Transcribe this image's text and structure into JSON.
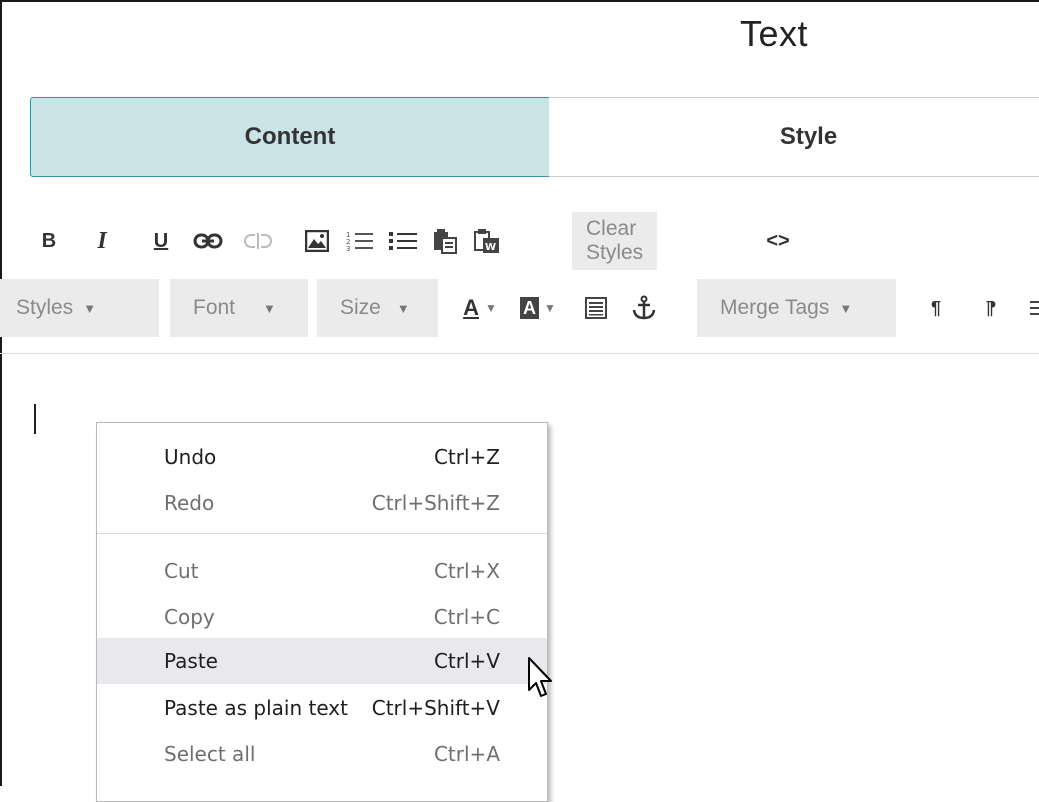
{
  "panel": {
    "title": "Text"
  },
  "tabs": [
    {
      "label": "Content",
      "active": true
    },
    {
      "label": "Style",
      "active": false
    }
  ],
  "toolbar": {
    "row1": {
      "bold": "B",
      "italic": "I",
      "underline": "U",
      "clear_styles": "Clear Styles",
      "source_glyph": "<>"
    },
    "row2": {
      "styles": "Styles",
      "font": "Font",
      "size": "Size",
      "text_color_glyph": "A",
      "bg_color_glyph": "A",
      "merge_tags": "Merge Tags",
      "ltr_glyph": "¶",
      "rtl_glyph": "¶"
    },
    "icons": [
      "bold-icon",
      "italic-icon",
      "underline-icon",
      "link-icon",
      "unlink-icon",
      "image-icon",
      "numbered-list-icon",
      "bulleted-list-icon",
      "paste-icon",
      "paste-from-word-icon",
      "source-code-icon",
      "text-color-icon",
      "background-color-icon",
      "justify-block-icon",
      "anchor-icon",
      "paragraph-ltr-icon",
      "paragraph-rtl-icon"
    ]
  },
  "context_menu": {
    "items": [
      {
        "label": "Undo",
        "shortcut": "Ctrl+Z",
        "enabled": true
      },
      {
        "label": "Redo",
        "shortcut": "Ctrl+Shift+Z",
        "enabled": false
      },
      {
        "label": "Cut",
        "shortcut": "Ctrl+X",
        "enabled": false
      },
      {
        "label": "Copy",
        "shortcut": "Ctrl+C",
        "enabled": false
      },
      {
        "label": "Paste",
        "shortcut": "Ctrl+V",
        "enabled": true,
        "hovered": true
      },
      {
        "label": "Paste as plain text",
        "shortcut": "Ctrl+Shift+V",
        "enabled": true
      },
      {
        "label": "Select all",
        "shortcut": "Ctrl+A",
        "enabled": false
      }
    ]
  },
  "colors": {
    "active_tab_bg": "#c9e3e7",
    "active_tab_border": "#3e8f9b",
    "toolbar_button_bg": "#ebebeb",
    "menu_hover_bg": "#e8e8ed"
  }
}
